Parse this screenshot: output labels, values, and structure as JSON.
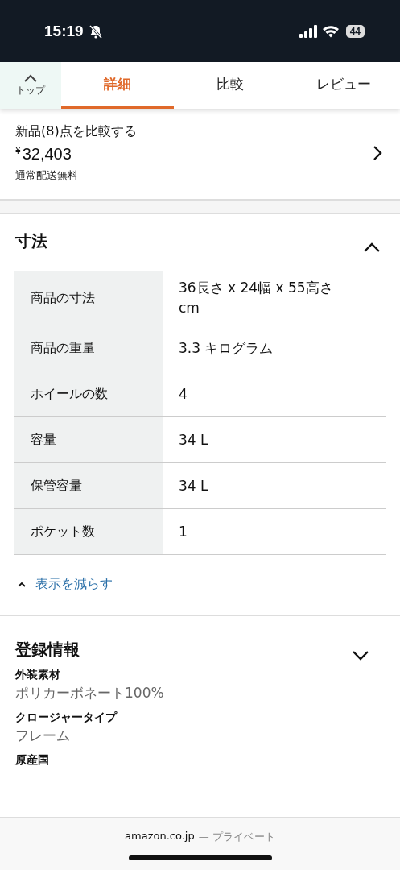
{
  "status_bar": {
    "time": "15:19",
    "silent": true,
    "battery": "44"
  },
  "tabs": [
    {
      "label": "詳細",
      "selected": true
    },
    {
      "label": "比較",
      "selected": false
    },
    {
      "label": "レビュー",
      "selected": false
    }
  ],
  "top_button": {
    "label": "トップ"
  },
  "offers": {
    "title": "新品(8)点を比較する",
    "currency": "¥",
    "price": "32,403",
    "shipping": "通常配送無料"
  },
  "dimensions": {
    "title": "寸法",
    "expanded": true,
    "rows": [
      {
        "label": "商品の寸法",
        "value": "36長さ x 24幅 x 55高さ cm"
      },
      {
        "label": "商品の重量",
        "value": "3.3 キログラム"
      },
      {
        "label": "ホイールの数",
        "value": "4"
      },
      {
        "label": "容量",
        "value": "34 L"
      },
      {
        "label": "保管容量",
        "value": "34 L"
      },
      {
        "label": "ポケット数",
        "value": "1"
      }
    ],
    "toggle_link": "表示を減らす"
  },
  "registration": {
    "title": "登録情報",
    "expanded": false,
    "items": [
      {
        "label": "外装素材",
        "value": "ポリカーボネート100%"
      },
      {
        "label": "クロージャータイプ",
        "value": "フレーム"
      },
      {
        "label": "原産国"
      }
    ]
  },
  "browser_bar": {
    "domain": "amazon.co.jp",
    "mode": "— プライベート"
  }
}
